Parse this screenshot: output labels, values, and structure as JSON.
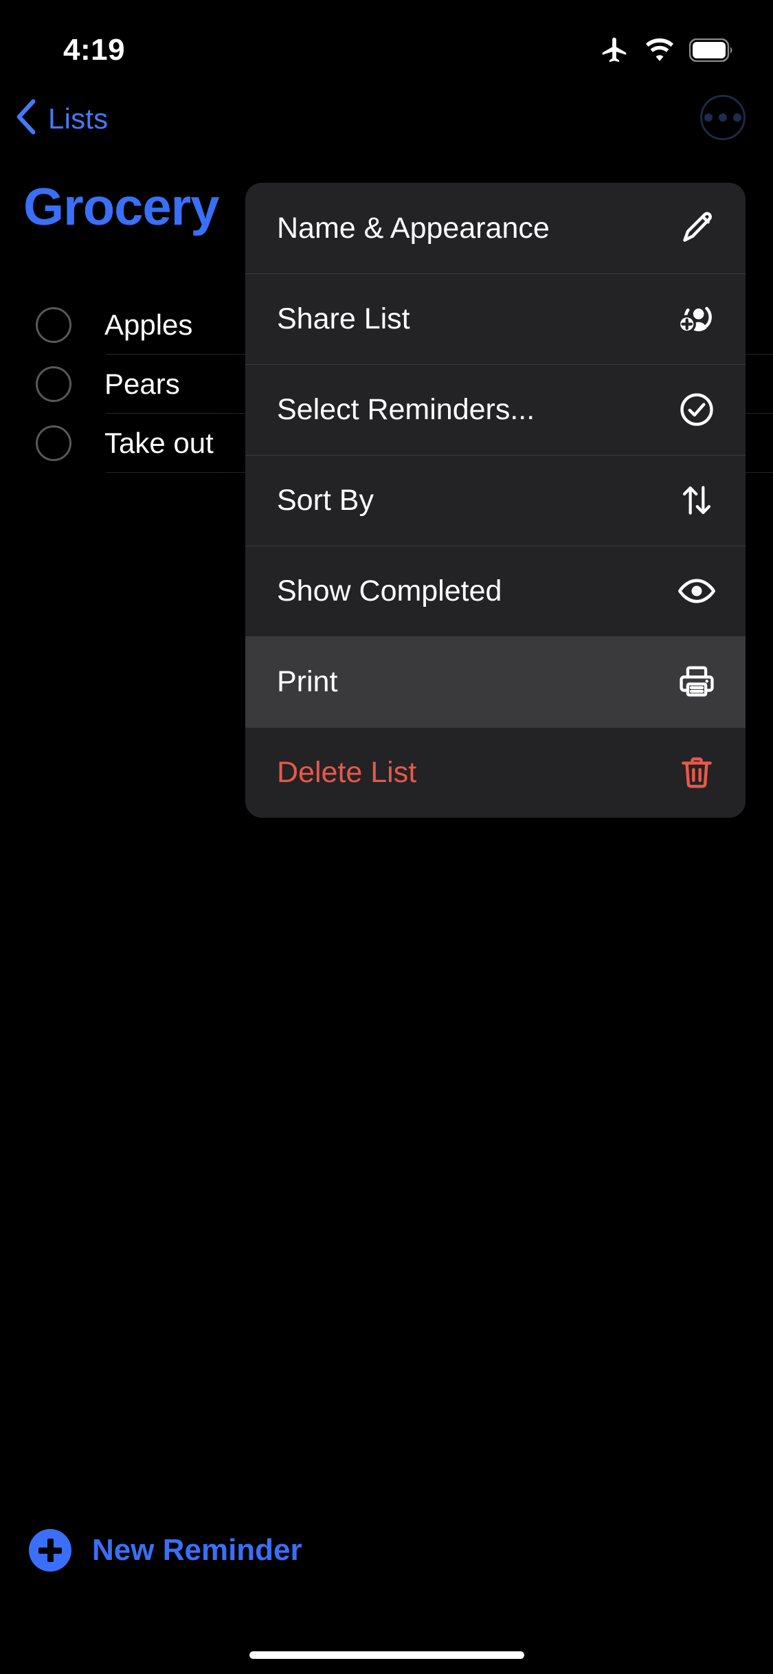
{
  "status_bar": {
    "time": "4:19",
    "icons": [
      "airplane-mode-icon",
      "wifi-icon",
      "battery-icon"
    ]
  },
  "nav_bar": {
    "back_label": "Lists",
    "back_icon": "chevron-left-icon",
    "more_icon": "ellipsis-circle-icon"
  },
  "list": {
    "title": "Grocery",
    "accent_color": "#3a6ff7",
    "reminders": [
      {
        "text": "Apples",
        "completed": false
      },
      {
        "text": "Pears",
        "completed": false
      },
      {
        "text": "Take out",
        "completed": false
      }
    ]
  },
  "context_menu": {
    "items": [
      {
        "label": "Name & Appearance",
        "icon": "pencil-icon",
        "style": "default",
        "highlighted": false
      },
      {
        "label": "Share List",
        "icon": "person-badge-plus-icon",
        "style": "default",
        "highlighted": false
      },
      {
        "label": "Select Reminders...",
        "icon": "checkmark-circle-icon",
        "style": "default",
        "highlighted": false
      },
      {
        "label": "Sort By",
        "icon": "arrow-up-arrow-down-icon",
        "style": "default",
        "highlighted": false
      },
      {
        "label": "Show Completed",
        "icon": "eye-icon",
        "style": "default",
        "highlighted": false
      },
      {
        "label": "Print",
        "icon": "printer-icon",
        "style": "default",
        "highlighted": true
      },
      {
        "label": "Delete List",
        "icon": "trash-icon",
        "style": "destructive",
        "highlighted": false
      }
    ],
    "destructive_color": "#e8584a",
    "background_color": "#232325",
    "highlight_color": "#3a3a3c"
  },
  "footer": {
    "new_reminder_label": "New Reminder",
    "new_reminder_icon": "plus-circle-icon"
  }
}
